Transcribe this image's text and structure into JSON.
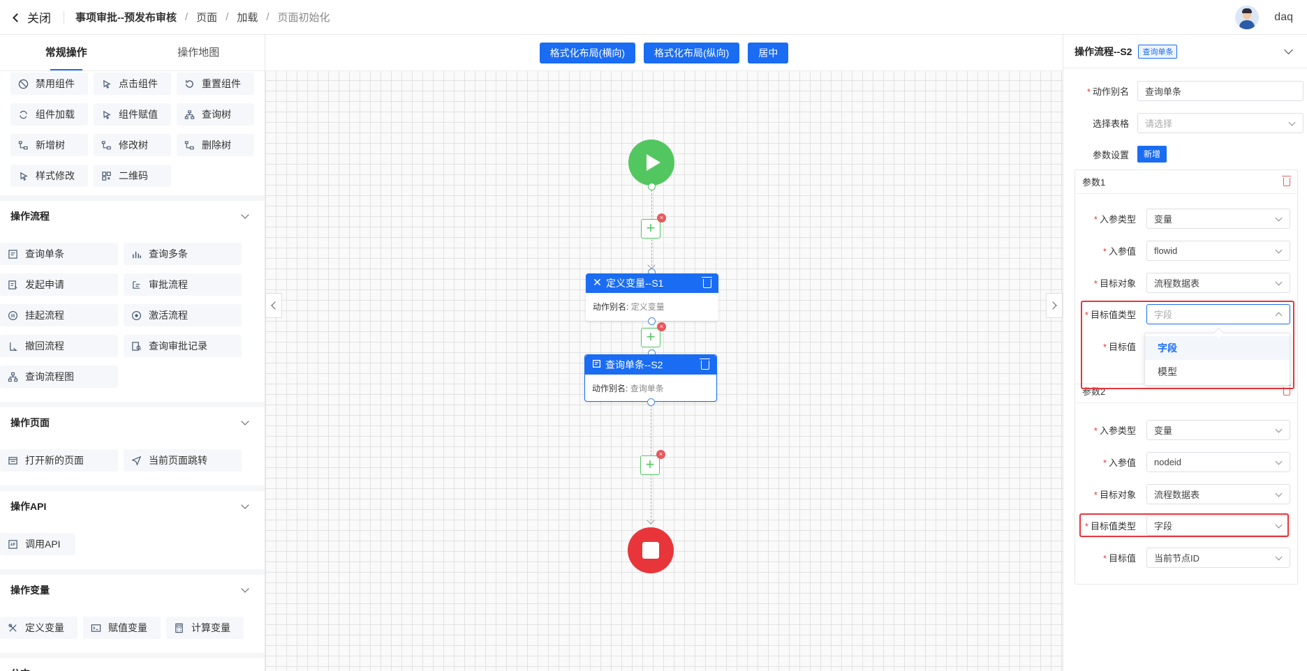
{
  "topbar": {
    "close_label": "关闭",
    "breadcrumb": [
      "事项审批--预发布审核",
      "页面",
      "加载",
      "页面初始化"
    ],
    "separator": "/",
    "username": "daq"
  },
  "left": {
    "tabs": [
      "常规操作",
      "操作地图"
    ],
    "common_items": [
      {
        "label": "禁用组件",
        "icon": "ban-icon"
      },
      {
        "label": "点击组件",
        "icon": "pointer-icon"
      },
      {
        "label": "重置组件",
        "icon": "reset-icon"
      },
      {
        "label": "组件加载",
        "icon": "refresh-icon"
      },
      {
        "label": "组件赋值",
        "icon": "pointer-icon"
      },
      {
        "label": "查询树",
        "icon": "tree-icon"
      },
      {
        "label": "新增树",
        "icon": "tree-add-icon"
      },
      {
        "label": "修改树",
        "icon": "tree-edit-icon"
      },
      {
        "label": "删除树",
        "icon": "tree-delete-icon"
      },
      {
        "label": "样式修改",
        "icon": "pointer-icon"
      },
      {
        "label": "二维码",
        "icon": "qrcode-icon"
      }
    ],
    "sections": [
      {
        "title": "操作流程",
        "items": [
          {
            "label": "查询单条",
            "icon": "query-single-icon"
          },
          {
            "label": "查询多条",
            "icon": "query-multi-icon"
          },
          {
            "label": "发起申请",
            "icon": "apply-icon"
          },
          {
            "label": "审批流程",
            "icon": "approve-icon"
          },
          {
            "label": "挂起流程",
            "icon": "pause-icon"
          },
          {
            "label": "激活流程",
            "icon": "activate-icon"
          },
          {
            "label": "撤回流程",
            "icon": "withdraw-icon"
          },
          {
            "label": "查询审批记录",
            "icon": "record-icon"
          },
          {
            "label": "查询流程图",
            "icon": "flowchart-icon"
          }
        ]
      },
      {
        "title": "操作页面",
        "items": [
          {
            "label": "打开新的页面",
            "icon": "open-page-icon"
          },
          {
            "label": "当前页面跳转",
            "icon": "send-icon"
          }
        ]
      },
      {
        "title": "操作API",
        "items": [
          {
            "label": "调用API",
            "icon": "api-icon"
          }
        ]
      },
      {
        "title": "操作变量",
        "items": [
          {
            "label": "定义变量",
            "icon": "define-var-icon"
          },
          {
            "label": "赋值变量",
            "icon": "assign-var-icon"
          },
          {
            "label": "计算变量",
            "icon": "calc-var-icon"
          }
        ]
      },
      {
        "title": "分支",
        "items": []
      }
    ]
  },
  "canvas": {
    "toolbar": [
      "格式化布局(横向)",
      "格式化布局(纵向)",
      "居中"
    ],
    "nodes": [
      {
        "title": "定义变量--S1",
        "alias_label": "动作别名:",
        "alias_value": "定义变量"
      },
      {
        "title": "查询单条--S2",
        "alias_label": "动作别名:",
        "alias_value": "查询单条"
      }
    ],
    "add_symbol": "+",
    "remove_symbol": "×"
  },
  "right": {
    "title": "操作流程--S2",
    "tag": "查询单条",
    "alias_label": "动作别名",
    "alias_value": "查询单条",
    "table_label": "选择表格",
    "table_placeholder": "请选择",
    "params_label": "参数设置",
    "add_label": "新增",
    "params": [
      {
        "name": "参数1",
        "fields": [
          {
            "label": "入参类型",
            "value": "变量"
          },
          {
            "label": "入参值",
            "value": "flowid"
          },
          {
            "label": "目标对象",
            "value": "流程数据表"
          },
          {
            "label": "目标值类型",
            "placeholder": "字段"
          },
          {
            "label": "目标值",
            "value": ""
          }
        ]
      },
      {
        "name": "参数2",
        "fields": [
          {
            "label": "入参类型",
            "value": "变量"
          },
          {
            "label": "入参值",
            "value": "nodeid"
          },
          {
            "label": "目标对象",
            "value": "流程数据表"
          },
          {
            "label": "目标值类型",
            "value": "字段"
          },
          {
            "label": "目标值",
            "value": "当前节点ID"
          }
        ]
      }
    ],
    "dropdown_options": [
      "字段",
      "模型"
    ],
    "required_mark": "*"
  },
  "colors": {
    "primary": "#1a6cf3",
    "start": "#52c760",
    "end": "#e8353a",
    "highlight": "#e8353a"
  }
}
